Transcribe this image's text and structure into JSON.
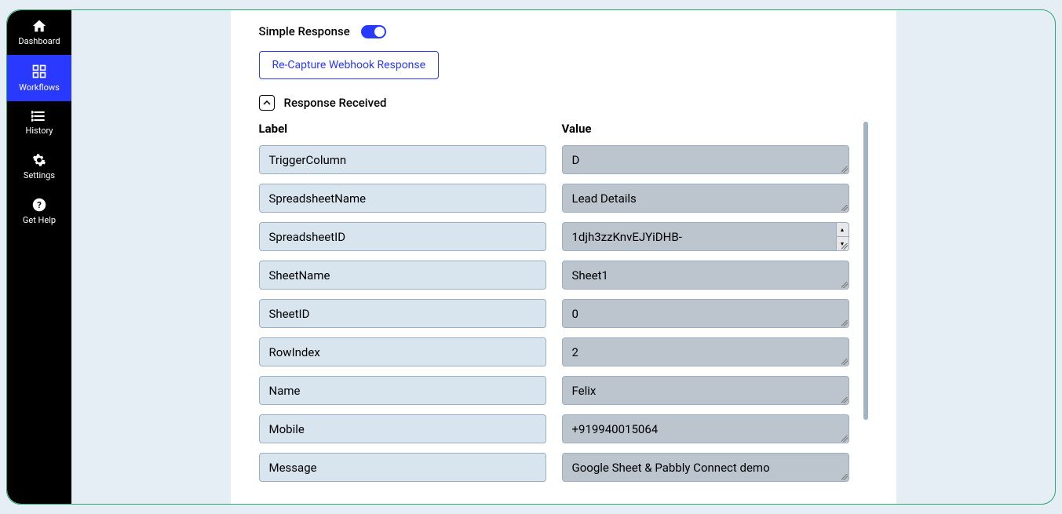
{
  "sidebar": {
    "items": [
      {
        "label": "Dashboard"
      },
      {
        "label": "Workflows"
      },
      {
        "label": "History"
      },
      {
        "label": "Settings"
      },
      {
        "label": "Get Help"
      }
    ]
  },
  "main": {
    "simple_response_label": "Simple Response",
    "recapture_label": "Re-Capture Webhook Response",
    "response_received_label": "Response Received",
    "label_header": "Label",
    "value_header": "Value",
    "rows": [
      {
        "label": "TriggerColumn",
        "value": "D"
      },
      {
        "label": "SpreadsheetName",
        "value": "Lead Details"
      },
      {
        "label": "SpreadsheetID",
        "value": "1djh3zzKnvEJYiDHB-"
      },
      {
        "label": "SheetName",
        "value": "Sheet1"
      },
      {
        "label": "SheetID",
        "value": "0"
      },
      {
        "label": "RowIndex",
        "value": "2"
      },
      {
        "label": "Name",
        "value": "Felix"
      },
      {
        "label": "Mobile",
        "value": "+919940015064"
      },
      {
        "label": "Message",
        "value": "Google Sheet & Pabbly Connect demo"
      }
    ]
  }
}
